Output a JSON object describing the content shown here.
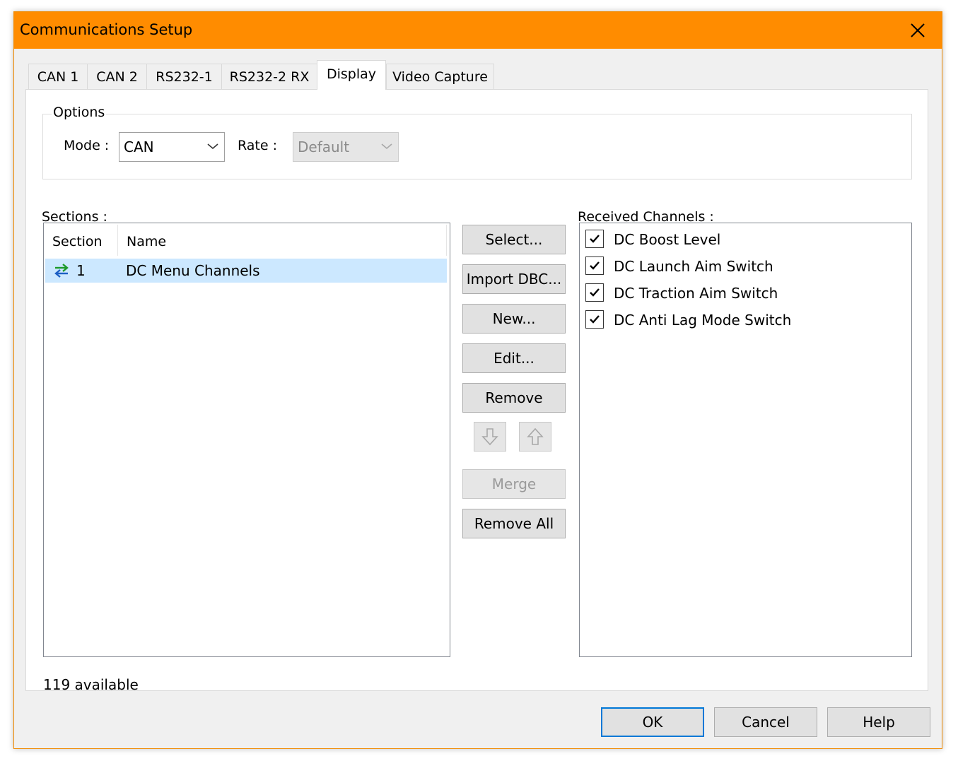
{
  "window": {
    "title": "Communications Setup",
    "accent_color": "#ff8c00"
  },
  "tabs": [
    {
      "label": "CAN 1"
    },
    {
      "label": "CAN 2"
    },
    {
      "label": "RS232-1"
    },
    {
      "label": "RS232-2 RX"
    },
    {
      "label": "Display",
      "active": true
    },
    {
      "label": "Video Capture"
    }
  ],
  "options": {
    "legend": "Options",
    "mode_label": "Mode :",
    "mode_value": "CAN",
    "rate_label": "Rate :",
    "rate_value": "Default"
  },
  "sections": {
    "label": "Sections :",
    "columns": [
      "Section",
      "Name"
    ],
    "rows": [
      {
        "section": "1",
        "name": "DC Menu Channels",
        "icon": "sync-arrows-icon",
        "selected": true
      }
    ],
    "available": "119 available"
  },
  "buttons": {
    "select": "Select...",
    "import_dbc": "Import DBC...",
    "new": "New...",
    "edit": "Edit...",
    "remove": "Remove",
    "merge": "Merge",
    "remove_all": "Remove All",
    "ok": "OK",
    "cancel": "Cancel",
    "help": "Help"
  },
  "channels": {
    "label": "Received Channels :",
    "items": [
      {
        "label": "DC Boost Level",
        "checked": true
      },
      {
        "label": "DC Launch Aim Switch",
        "checked": true
      },
      {
        "label": "DC Traction Aim Switch",
        "checked": true
      },
      {
        "label": "DC Anti Lag Mode Switch",
        "checked": true
      }
    ]
  }
}
